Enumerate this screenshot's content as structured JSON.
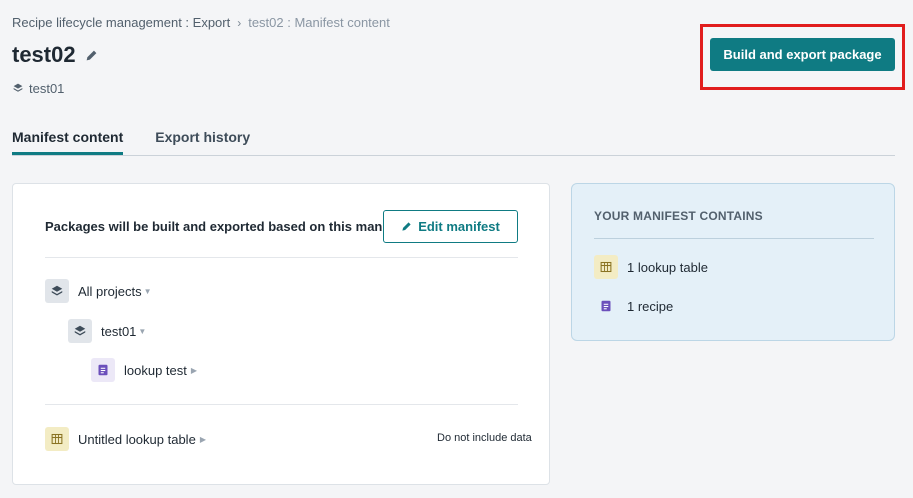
{
  "breadcrumb": {
    "parent": "Recipe lifecycle management : Export",
    "separator": "›",
    "current": "test02 : Manifest content"
  },
  "page": {
    "title": "test02",
    "project": "test01"
  },
  "actions": {
    "build_export": "Build and export package"
  },
  "tabs": [
    {
      "label": "Manifest content",
      "active": true
    },
    {
      "label": "Export history",
      "active": false
    }
  ],
  "manifest": {
    "description": "Packages will be built and exported based on this manifest",
    "edit_label": "Edit manifest",
    "tree": {
      "root": "All projects",
      "project": "test01",
      "recipe": "lookup test"
    },
    "lookup_table": {
      "name": "Untitled lookup table",
      "data_option": "Do not include data"
    }
  },
  "summary": {
    "title": "YOUR MANIFEST CONTAINS",
    "items": [
      {
        "label": "1 lookup table",
        "icon": "table-icon"
      },
      {
        "label": "1 recipe",
        "icon": "recipe-icon"
      }
    ]
  },
  "colors": {
    "accent": "#0f7b83",
    "highlight": "#e11d1d",
    "summary_bg": "#e4f0f8"
  }
}
